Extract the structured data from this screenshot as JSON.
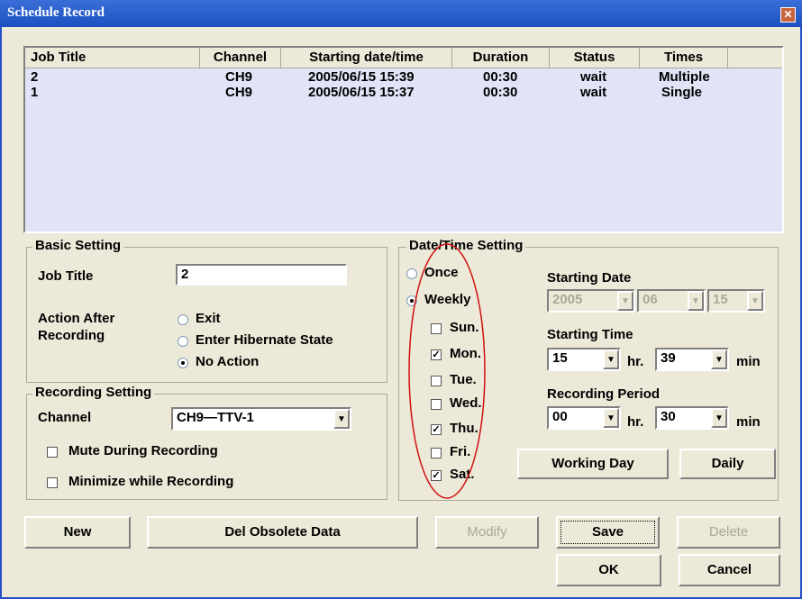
{
  "window": {
    "title": "Schedule Record",
    "close_glyph": "✕"
  },
  "list": {
    "columns": [
      "Job Title",
      "Channel",
      "Starting date/time",
      "Duration",
      "Status",
      "Times"
    ],
    "rows": [
      {
        "job_title": "2",
        "channel": "CH9",
        "start": "2005/06/15 15:39",
        "duration": "00:30",
        "status": "wait",
        "times": "Multiple"
      },
      {
        "job_title": "1",
        "channel": "CH9",
        "start": "2005/06/15 15:37",
        "duration": "00:30",
        "status": "wait",
        "times": "Single"
      }
    ]
  },
  "basic": {
    "legend": "Basic Setting",
    "job_title_label": "Job Title",
    "job_title_value": "2",
    "action_label_line1": "Action After",
    "action_label_line2": "Recording",
    "actions": [
      "Exit",
      "Enter Hibernate State",
      "No Action"
    ],
    "selected_action": "No Action"
  },
  "recording": {
    "legend": "Recording Setting",
    "channel_label": "Channel",
    "channel_value": "CH9—TTV-1",
    "mute_label": "Mute During Recording",
    "mute_checked": false,
    "minimize_label": "Minimize while Recording",
    "minimize_checked": false
  },
  "datetime": {
    "legend": "Date/Time Setting",
    "once_label": "Once",
    "weekly_label": "Weekly",
    "mode": "Weekly",
    "days": [
      {
        "label": "Sun.",
        "checked": false
      },
      {
        "label": "Mon.",
        "checked": true
      },
      {
        "label": "Tue.",
        "checked": false
      },
      {
        "label": "Wed.",
        "checked": false
      },
      {
        "label": "Thu.",
        "checked": true
      },
      {
        "label": "Fri.",
        "checked": false
      },
      {
        "label": "Sat.",
        "checked": true
      }
    ],
    "starting_date_label": "Starting Date",
    "date_year": "2005",
    "date_month": "06",
    "date_day": "15",
    "starting_time_label": "Starting Time",
    "time_hr": "15",
    "time_min": "39",
    "recording_period_label": "Recording Period",
    "period_hr": "00",
    "period_min": "30",
    "hr_unit": "hr.",
    "min_unit": "min",
    "working_day_label": "Working Day",
    "daily_label": "Daily",
    "annotation_color": "#d01010"
  },
  "buttons": {
    "new": "New",
    "del_obsolete": "Del Obsolete Data",
    "modify": "Modify",
    "save": "Save",
    "delete": "Delete",
    "ok": "OK",
    "cancel": "Cancel"
  }
}
